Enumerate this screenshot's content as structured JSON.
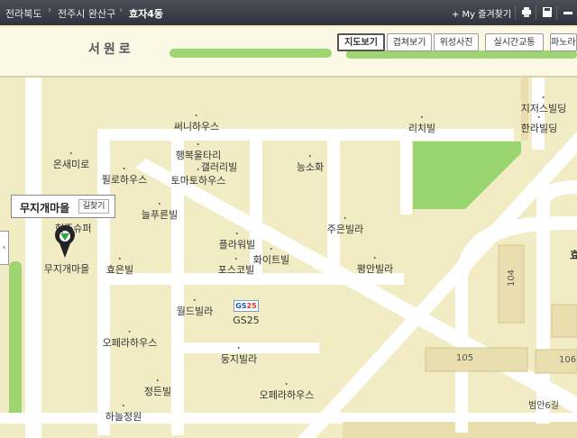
{
  "breadcrumb": {
    "province": "전라북도",
    "city": "전주시 완산구",
    "dong": "효자4동"
  },
  "toolbar": {
    "favorites": "+ My 즐겨찾기",
    "icons": [
      "print-icon",
      "save-icon",
      "minimize-icon"
    ]
  },
  "map_buttons": [
    {
      "label": "지도보기",
      "active": true
    },
    {
      "label": "겹쳐보기",
      "active": false
    },
    {
      "label": "위성사진",
      "active": false
    },
    {
      "label": "실시간교통",
      "active": false
    },
    {
      "label": "파노라마",
      "active": false
    }
  ],
  "road_name": "서원로",
  "popup": {
    "title": "무지개마을",
    "directions_button": "길찾기"
  },
  "sidebar_toggle": "‹",
  "poi": {
    "sunny_house": "써니하우스",
    "richville": "리치빌",
    "gigeoseu_building": "지저스빌딩",
    "hanaribill": "한라빌딩",
    "onsaemiro": "온새미로",
    "haengbok_eultari": "행복울타리",
    "galleryville": "갤러리빌",
    "nungsohwa": "능소화",
    "pillo_house": "필로하우스",
    "tomato_villa": "토마토하우스",
    "neulpureun_ville": "늘푸른빌",
    "jueun_villa": "주은빌라",
    "hyeonju_super": "현주슈퍼",
    "plaraville": "플라워빌",
    "white_villa": "화이트빌",
    "pyeongan_villa": "평안빌라",
    "mujigae_maeul": "무지개마을",
    "hyoeun_villa": "효은빌",
    "posco_villa": "포스코빌",
    "world_villa": "월드빌라",
    "gs25": "GS25",
    "opera_house_1": "오페라하우스",
    "dungji_villa": "둥지빌라",
    "jeongdeun_villa": "정든빌",
    "opera_house_2": "오페라하우스",
    "haneul_jeongwon": "하늘정원",
    "lot_104": "104",
    "lot_105": "105",
    "lot_106": "106",
    "beoman6gil": "범안6길",
    "partial_hyo": "효"
  },
  "colors": {
    "land": "#f1ecc4",
    "road": "#ffffff",
    "park": "#99d56f",
    "block": "#e9dfae",
    "topbar": "#3c3f46"
  }
}
